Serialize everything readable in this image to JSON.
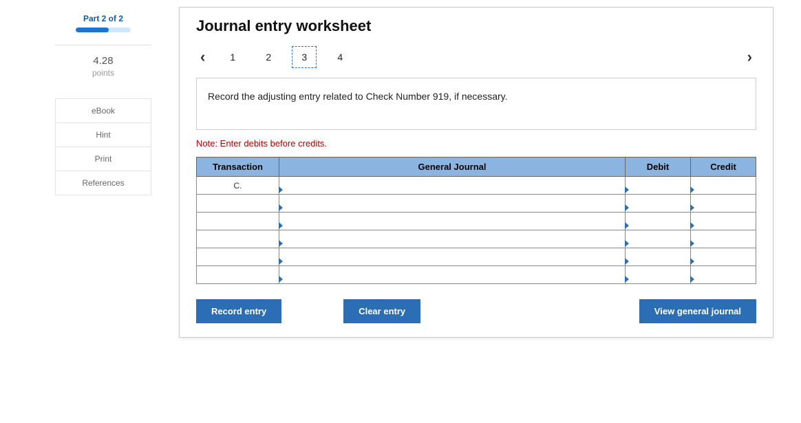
{
  "sidebar": {
    "part_label": "Part 2 of 2",
    "points_value": "4.28",
    "points_label": "points",
    "links": {
      "ebook": "eBook",
      "hint": "Hint",
      "print": "Print",
      "references": "References"
    }
  },
  "main": {
    "title": "Journal entry worksheet",
    "steps": [
      "1",
      "2",
      "3",
      "4"
    ],
    "active_step_index": 2,
    "instruction": "Record the adjusting entry related to Check Number 919, if necessary.",
    "note": "Note: Enter debits before credits.",
    "table": {
      "headers": {
        "transaction": "Transaction",
        "journal": "General Journal",
        "debit": "Debit",
        "credit": "Credit"
      },
      "rows": [
        {
          "transaction": "C.",
          "journal": "",
          "debit": "",
          "credit": ""
        },
        {
          "transaction": "",
          "journal": "",
          "debit": "",
          "credit": ""
        },
        {
          "transaction": "",
          "journal": "",
          "debit": "",
          "credit": ""
        },
        {
          "transaction": "",
          "journal": "",
          "debit": "",
          "credit": ""
        },
        {
          "transaction": "",
          "journal": "",
          "debit": "",
          "credit": ""
        },
        {
          "transaction": "",
          "journal": "",
          "debit": "",
          "credit": ""
        }
      ]
    },
    "buttons": {
      "record": "Record entry",
      "clear": "Clear entry",
      "view": "View general journal"
    }
  }
}
